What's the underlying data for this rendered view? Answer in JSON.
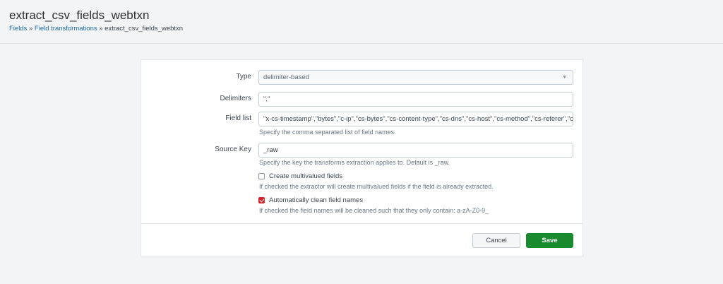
{
  "header": {
    "title": "extract_csv_fields_webtxn",
    "breadcrumb": {
      "fields": "Fields",
      "sep1": " » ",
      "transformations": "Field transformations",
      "sep2": " » ",
      "current": "extract_csv_fields_webtxn"
    }
  },
  "form": {
    "type": {
      "label": "Type",
      "value": "delimiter-based"
    },
    "delimiters": {
      "label": "Delimiters",
      "value": "\",\""
    },
    "field_list": {
      "label": "Field list",
      "value": "\"x-cs-timestamp\",\"bytes\",\"c-ip\",\"cs-bytes\",\"cs-content-type\",\"cs-dns\",\"cs-host\",\"cs-method\",\"cs-referer\",\"cs-uri\",\"c",
      "help": "Specify the comma separated list of field names."
    },
    "source_key": {
      "label": "Source Key",
      "value": "_raw",
      "help": "Specify the key the transforms extraction applies to. Default is _raw."
    },
    "multivalued": {
      "label": "Create multivalued fields",
      "checked": false,
      "help": "If checked the extractor will create multivalued fields if the field is already extracted."
    },
    "clean_names": {
      "label": "Automatically clean field names",
      "checked": true,
      "help": "If checked the field names will be cleaned such that they only contain: a-zA-Z0-9_"
    }
  },
  "buttons": {
    "cancel": "Cancel",
    "save": "Save"
  },
  "colors": {
    "save": "#1a8a2f",
    "checkbox_checked": "#d6232a",
    "link": "#1a6aa8"
  }
}
